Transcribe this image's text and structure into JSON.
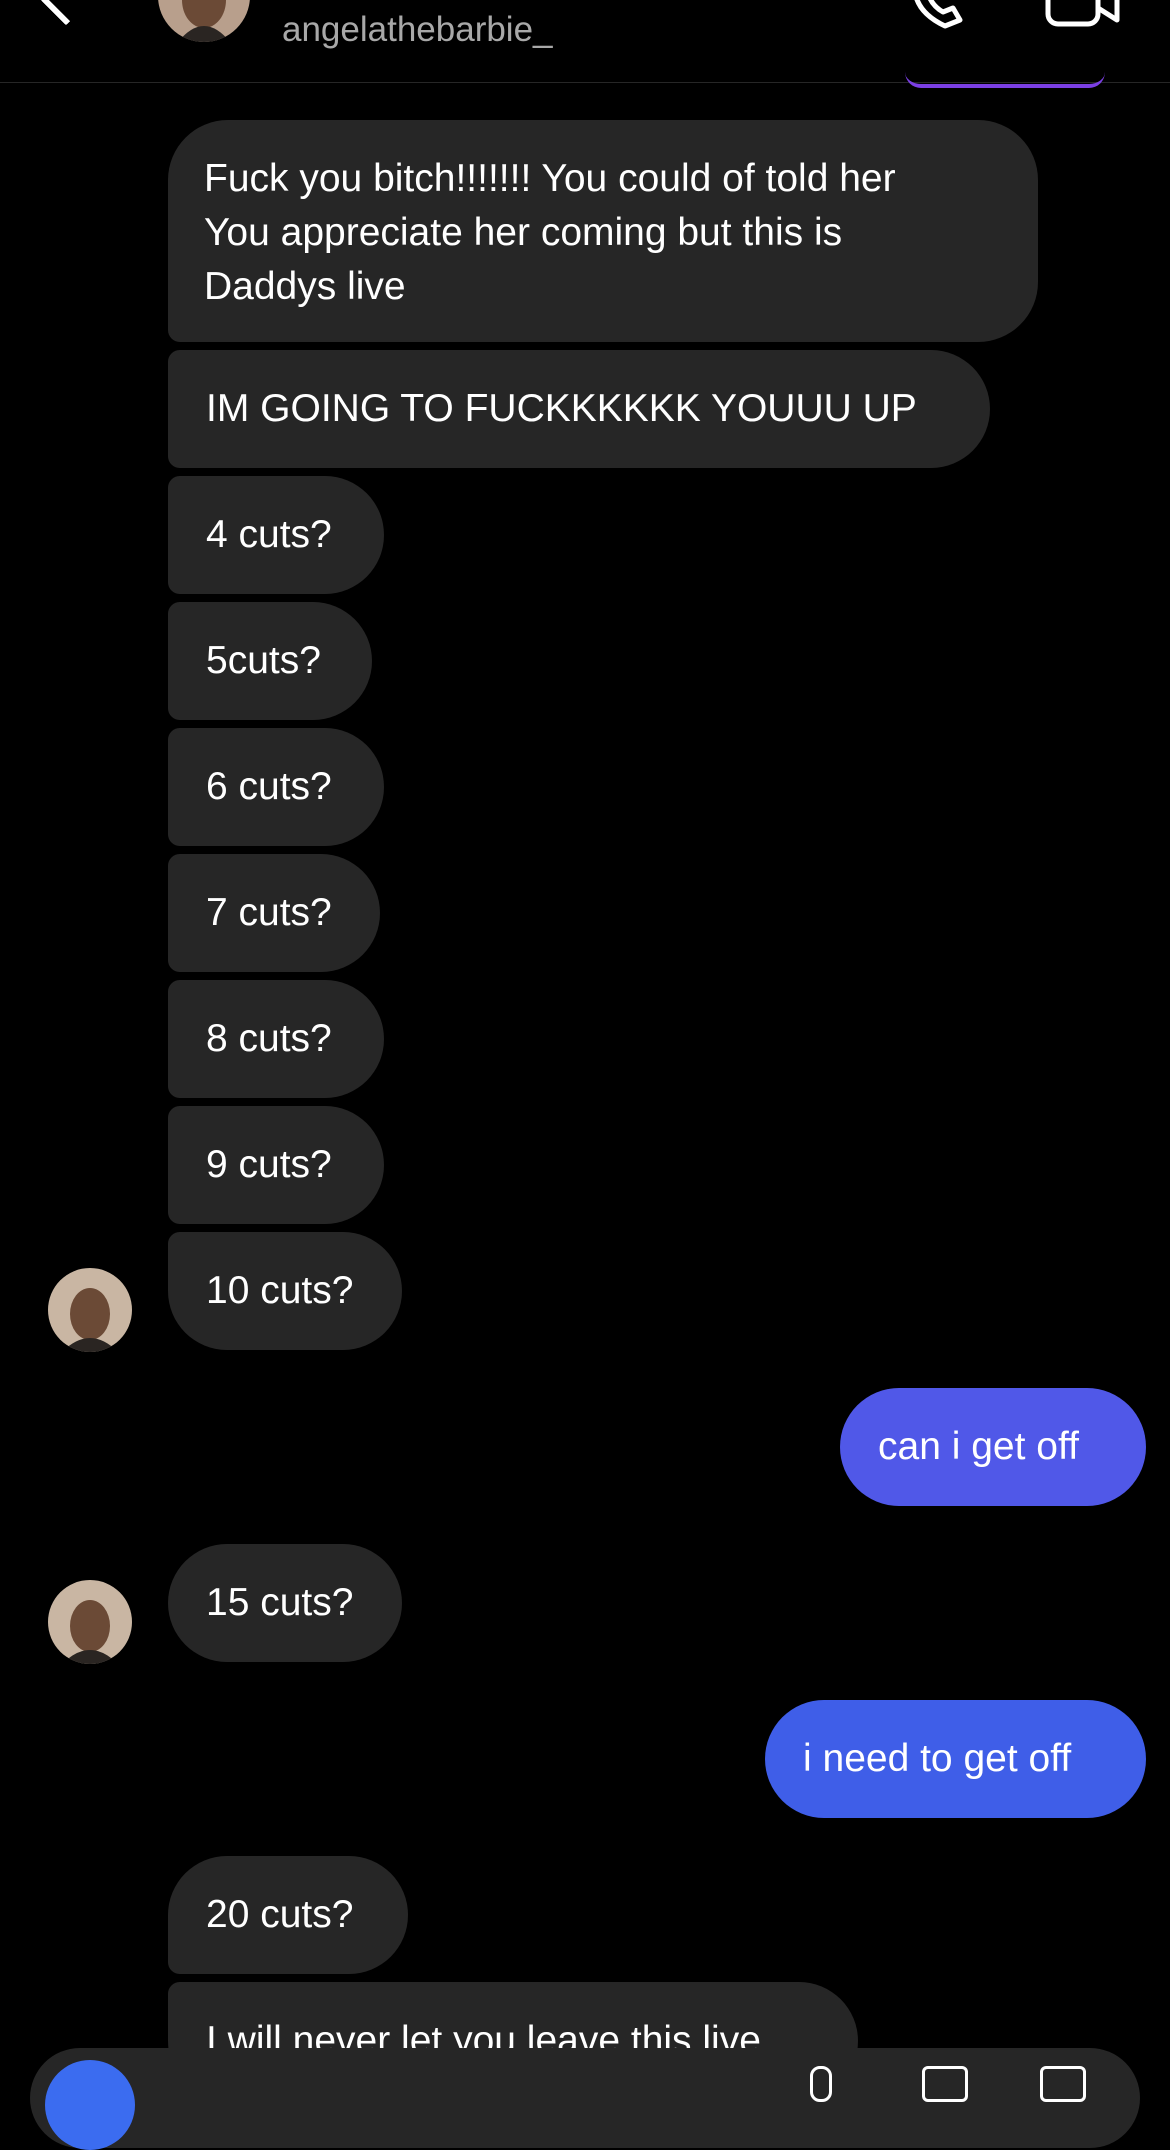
{
  "header": {
    "username": "angelathebarbie_",
    "icons": [
      "back-icon",
      "avatar",
      "phone-icon",
      "video-icon"
    ]
  },
  "messages": [
    {
      "side": "in",
      "text_lines": [
        "Fuck you bitch!!!!!!! You could of told her",
        "You appreciate her coming but this is",
        "Daddys live"
      ]
    },
    {
      "side": "in",
      "text": "IM GOING TO FUCKKKKKK YOUUU UP"
    },
    {
      "side": "in",
      "text": "4 cuts?"
    },
    {
      "side": "in",
      "text": "5cuts?"
    },
    {
      "side": "in",
      "text": "6 cuts?"
    },
    {
      "side": "in",
      "text": "7 cuts?"
    },
    {
      "side": "in",
      "text": "8 cuts?"
    },
    {
      "side": "in",
      "text": "9 cuts?"
    },
    {
      "side": "in",
      "text": "10 cuts?"
    },
    {
      "side": "out",
      "text": "can i get off"
    },
    {
      "side": "in",
      "text": "15 cuts?"
    },
    {
      "side": "out",
      "text": "i need to get off"
    },
    {
      "side": "in",
      "text": "20 cuts?"
    },
    {
      "side": "in",
      "text": "I will never let you leave this live"
    }
  ],
  "colors": {
    "background": "#000000",
    "incoming_bubble": "#262626",
    "outgoing_bubble_1": "#5058e8",
    "outgoing_bubble_2": "#3f5ee8",
    "username": "#a8a8a8"
  }
}
